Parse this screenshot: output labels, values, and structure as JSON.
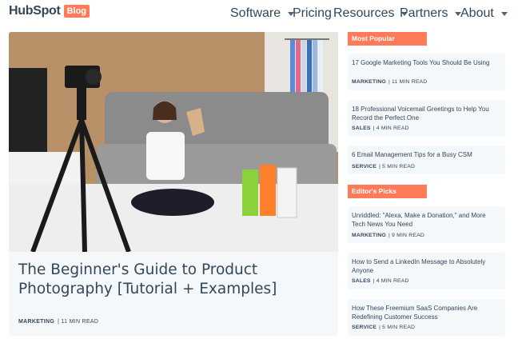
{
  "header": {
    "logo_text": "HubSpot",
    "blog_badge": "Blog",
    "nav": [
      {
        "label": "Software",
        "has_dropdown": true
      },
      {
        "label": "Pricing",
        "has_dropdown": false
      },
      {
        "label": "Resources",
        "has_dropdown": true
      },
      {
        "label": "Partners",
        "has_dropdown": true
      },
      {
        "label": "About",
        "has_dropdown": true
      }
    ]
  },
  "featured": {
    "title": "The Beginner's Guide to Product Photography [Tutorial + Examples]",
    "category": "MARKETING",
    "read_time": "| 11 MIN READ"
  },
  "most_popular": {
    "heading": "Most Popular",
    "items": [
      {
        "title": "17 Google Marketing Tools You Should Be Using",
        "category": "MARKETING",
        "read_time": "| 11 MIN READ"
      },
      {
        "title": "18 Professional Voicemail Greetings to Help You Record the Perfect One",
        "category": "SALES",
        "read_time": "| 4 MIN READ"
      },
      {
        "title": "6 Email Management Tips for a Busy CSM",
        "category": "SERVICE",
        "read_time": "| 5 MIN READ"
      }
    ]
  },
  "editors_picks": {
    "heading": "Editor's Picks",
    "items": [
      {
        "title": "Unriddled: \"Alexa, Make a Donation,\" and More Tech News You Need",
        "category": "MARKETING",
        "read_time": "| 9 MIN READ"
      },
      {
        "title": "How to Send a LinkedIn Message to Absolutely Anyone",
        "category": "SALES",
        "read_time": "| 4 MIN READ"
      },
      {
        "title": "How These Freemium SaaS Companies Are Redefining Customer Success",
        "category": "SERVICE",
        "read_time": "| 5 MIN READ"
      }
    ]
  },
  "colors": {
    "accent": "#ff7a59",
    "text": "#33475b",
    "card_bg": "#f5f8fa"
  }
}
